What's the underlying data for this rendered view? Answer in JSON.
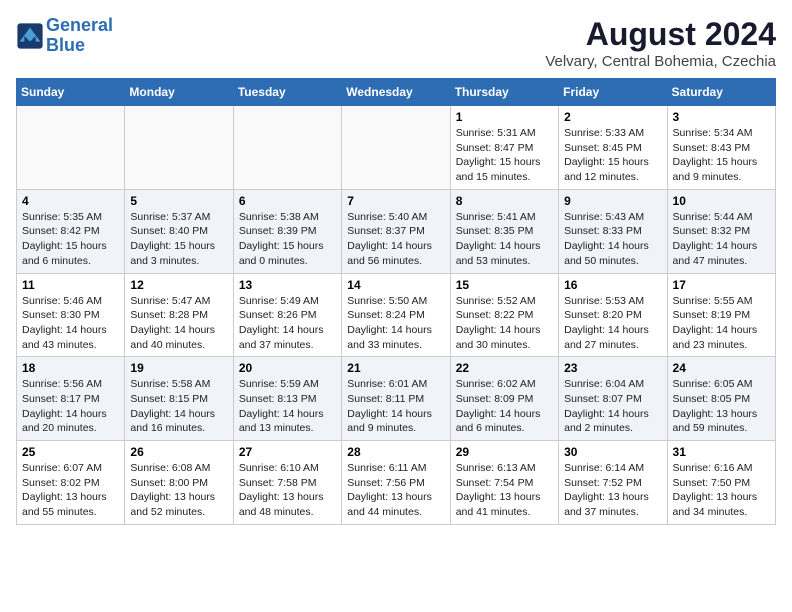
{
  "header": {
    "logo_line1": "General",
    "logo_line2": "Blue",
    "title": "August 2024",
    "subtitle": "Velvary, Central Bohemia, Czechia"
  },
  "weekdays": [
    "Sunday",
    "Monday",
    "Tuesday",
    "Wednesday",
    "Thursday",
    "Friday",
    "Saturday"
  ],
  "weeks": [
    [
      {
        "day": "",
        "info": ""
      },
      {
        "day": "",
        "info": ""
      },
      {
        "day": "",
        "info": ""
      },
      {
        "day": "",
        "info": ""
      },
      {
        "day": "1",
        "info": "Sunrise: 5:31 AM\nSunset: 8:47 PM\nDaylight: 15 hours\nand 15 minutes."
      },
      {
        "day": "2",
        "info": "Sunrise: 5:33 AM\nSunset: 8:45 PM\nDaylight: 15 hours\nand 12 minutes."
      },
      {
        "day": "3",
        "info": "Sunrise: 5:34 AM\nSunset: 8:43 PM\nDaylight: 15 hours\nand 9 minutes."
      }
    ],
    [
      {
        "day": "4",
        "info": "Sunrise: 5:35 AM\nSunset: 8:42 PM\nDaylight: 15 hours\nand 6 minutes."
      },
      {
        "day": "5",
        "info": "Sunrise: 5:37 AM\nSunset: 8:40 PM\nDaylight: 15 hours\nand 3 minutes."
      },
      {
        "day": "6",
        "info": "Sunrise: 5:38 AM\nSunset: 8:39 PM\nDaylight: 15 hours\nand 0 minutes."
      },
      {
        "day": "7",
        "info": "Sunrise: 5:40 AM\nSunset: 8:37 PM\nDaylight: 14 hours\nand 56 minutes."
      },
      {
        "day": "8",
        "info": "Sunrise: 5:41 AM\nSunset: 8:35 PM\nDaylight: 14 hours\nand 53 minutes."
      },
      {
        "day": "9",
        "info": "Sunrise: 5:43 AM\nSunset: 8:33 PM\nDaylight: 14 hours\nand 50 minutes."
      },
      {
        "day": "10",
        "info": "Sunrise: 5:44 AM\nSunset: 8:32 PM\nDaylight: 14 hours\nand 47 minutes."
      }
    ],
    [
      {
        "day": "11",
        "info": "Sunrise: 5:46 AM\nSunset: 8:30 PM\nDaylight: 14 hours\nand 43 minutes."
      },
      {
        "day": "12",
        "info": "Sunrise: 5:47 AM\nSunset: 8:28 PM\nDaylight: 14 hours\nand 40 minutes."
      },
      {
        "day": "13",
        "info": "Sunrise: 5:49 AM\nSunset: 8:26 PM\nDaylight: 14 hours\nand 37 minutes."
      },
      {
        "day": "14",
        "info": "Sunrise: 5:50 AM\nSunset: 8:24 PM\nDaylight: 14 hours\nand 33 minutes."
      },
      {
        "day": "15",
        "info": "Sunrise: 5:52 AM\nSunset: 8:22 PM\nDaylight: 14 hours\nand 30 minutes."
      },
      {
        "day": "16",
        "info": "Sunrise: 5:53 AM\nSunset: 8:20 PM\nDaylight: 14 hours\nand 27 minutes."
      },
      {
        "day": "17",
        "info": "Sunrise: 5:55 AM\nSunset: 8:19 PM\nDaylight: 14 hours\nand 23 minutes."
      }
    ],
    [
      {
        "day": "18",
        "info": "Sunrise: 5:56 AM\nSunset: 8:17 PM\nDaylight: 14 hours\nand 20 minutes."
      },
      {
        "day": "19",
        "info": "Sunrise: 5:58 AM\nSunset: 8:15 PM\nDaylight: 14 hours\nand 16 minutes."
      },
      {
        "day": "20",
        "info": "Sunrise: 5:59 AM\nSunset: 8:13 PM\nDaylight: 14 hours\nand 13 minutes."
      },
      {
        "day": "21",
        "info": "Sunrise: 6:01 AM\nSunset: 8:11 PM\nDaylight: 14 hours\nand 9 minutes."
      },
      {
        "day": "22",
        "info": "Sunrise: 6:02 AM\nSunset: 8:09 PM\nDaylight: 14 hours\nand 6 minutes."
      },
      {
        "day": "23",
        "info": "Sunrise: 6:04 AM\nSunset: 8:07 PM\nDaylight: 14 hours\nand 2 minutes."
      },
      {
        "day": "24",
        "info": "Sunrise: 6:05 AM\nSunset: 8:05 PM\nDaylight: 13 hours\nand 59 minutes."
      }
    ],
    [
      {
        "day": "25",
        "info": "Sunrise: 6:07 AM\nSunset: 8:02 PM\nDaylight: 13 hours\nand 55 minutes."
      },
      {
        "day": "26",
        "info": "Sunrise: 6:08 AM\nSunset: 8:00 PM\nDaylight: 13 hours\nand 52 minutes."
      },
      {
        "day": "27",
        "info": "Sunrise: 6:10 AM\nSunset: 7:58 PM\nDaylight: 13 hours\nand 48 minutes."
      },
      {
        "day": "28",
        "info": "Sunrise: 6:11 AM\nSunset: 7:56 PM\nDaylight: 13 hours\nand 44 minutes."
      },
      {
        "day": "29",
        "info": "Sunrise: 6:13 AM\nSunset: 7:54 PM\nDaylight: 13 hours\nand 41 minutes."
      },
      {
        "day": "30",
        "info": "Sunrise: 6:14 AM\nSunset: 7:52 PM\nDaylight: 13 hours\nand 37 minutes."
      },
      {
        "day": "31",
        "info": "Sunrise: 6:16 AM\nSunset: 7:50 PM\nDaylight: 13 hours\nand 34 minutes."
      }
    ]
  ]
}
